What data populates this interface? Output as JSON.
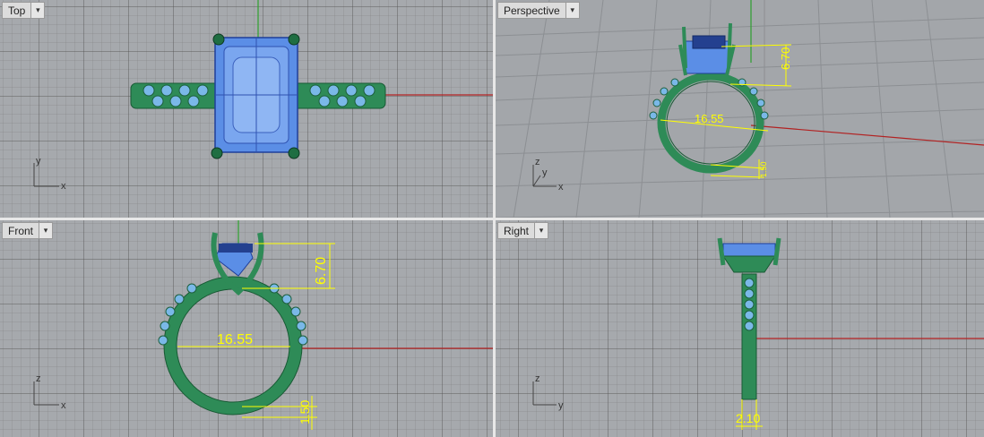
{
  "viewports": {
    "top": {
      "label": "Top",
      "axis_x": "x",
      "axis_y": "y"
    },
    "perspective": {
      "label": "Perspective",
      "axis_x": "x",
      "axis_y": "y",
      "axis_z": "z"
    },
    "front": {
      "label": "Front",
      "axis_x": "x",
      "axis_y": "z"
    },
    "right": {
      "label": "Right",
      "axis_x": "y",
      "axis_y": "z"
    }
  },
  "dropdown_glyph": "▾",
  "dimensions": {
    "inner_diameter": "16.55",
    "setting_height": "6.70",
    "band_thickness": "1.50",
    "band_width": "2.10"
  },
  "colors": {
    "viewport_bg": "#a6a9ad",
    "metal": "#2e8b57",
    "stone": "#5b8ee6",
    "accent_stones": "#7ab8e8",
    "dimension": "#ffff00",
    "x_axis": "#b22222",
    "y_axis": "#2ea02e"
  }
}
